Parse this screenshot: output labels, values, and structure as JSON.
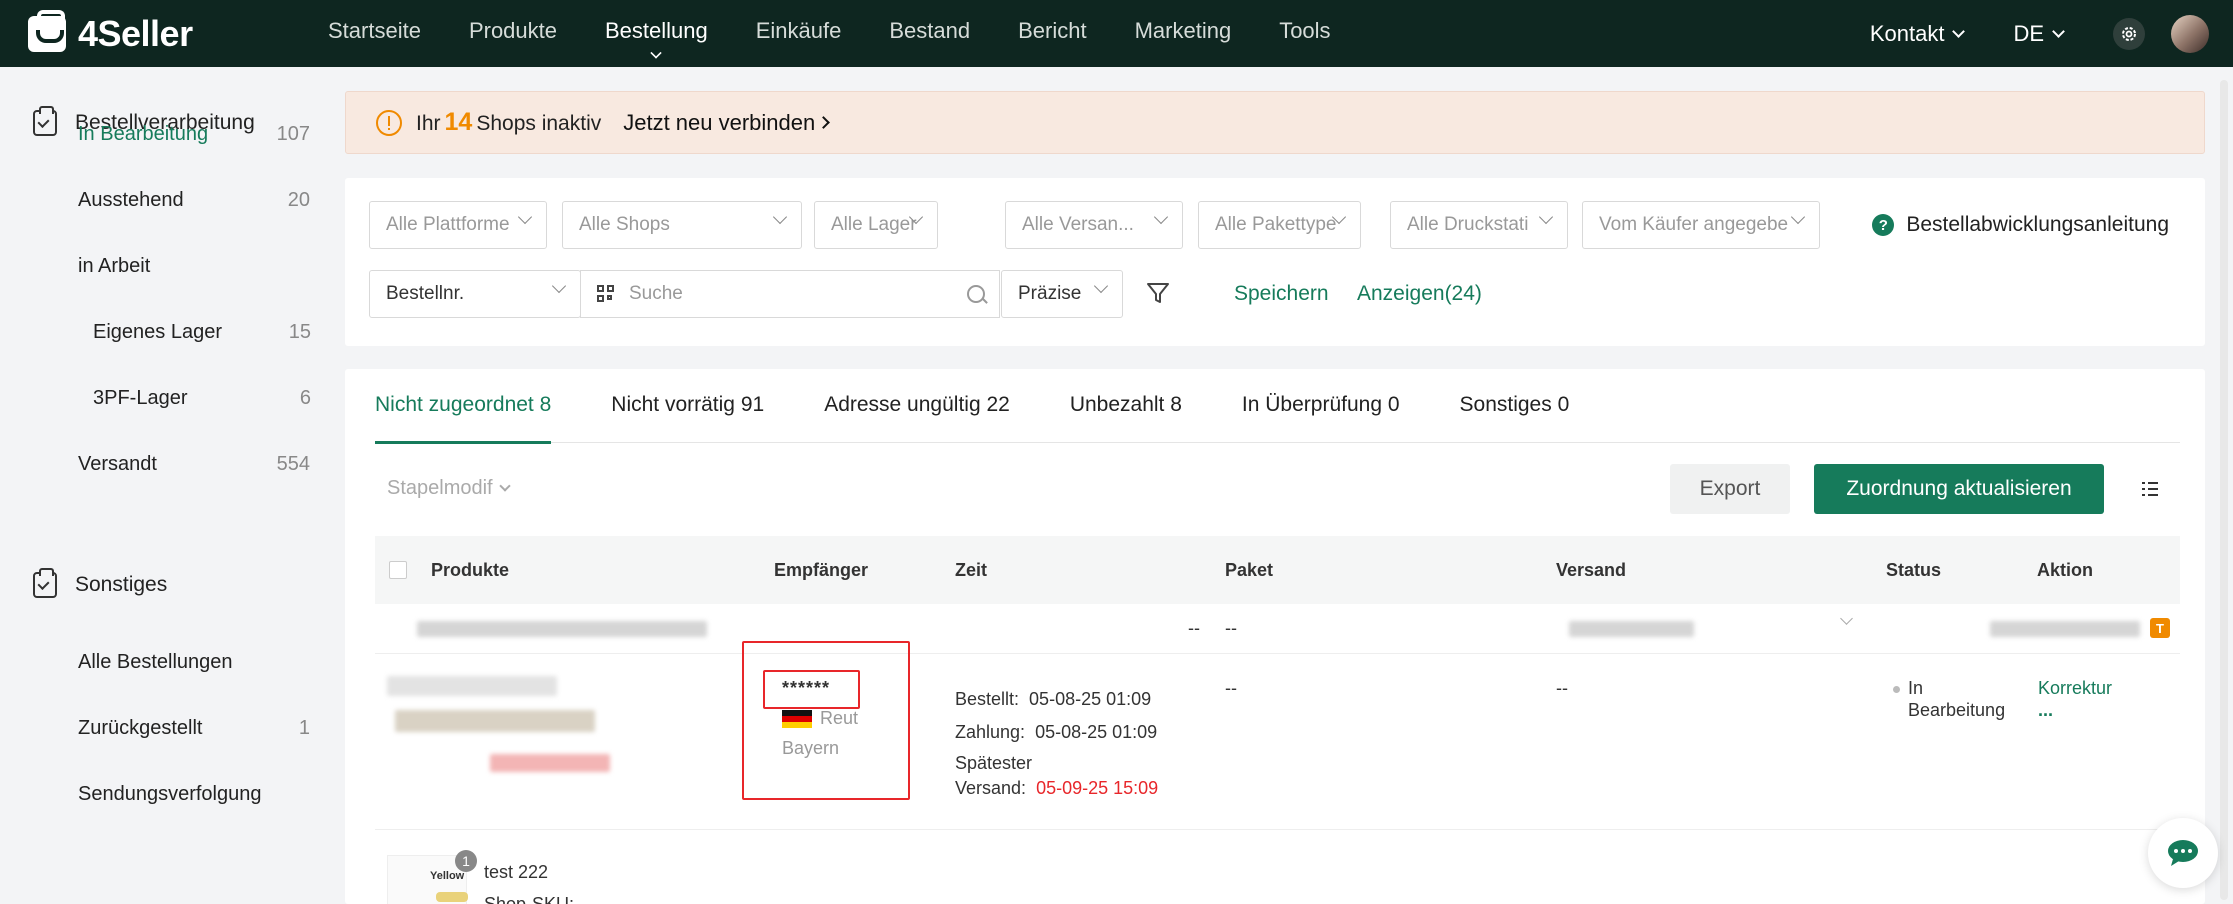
{
  "brand": {
    "name": "4Seller"
  },
  "nav": {
    "items": [
      "Startseite",
      "Produkte",
      "Bestellung",
      "Einkäufe",
      "Bestand",
      "Bericht",
      "Marketing",
      "Tools"
    ],
    "active": "Bestellung",
    "kontakt": "Kontakt",
    "language": "DE"
  },
  "sidebar": {
    "group1": "Bestellverarbeitung",
    "in_bearbeitung": {
      "label": "In Bearbeitung",
      "count": "107"
    },
    "ausstehend": {
      "label": "Ausstehend",
      "count": "20"
    },
    "in_arbeit": {
      "label": "in Arbeit"
    },
    "eigenes_lager": {
      "label": "Eigenes Lager",
      "count": "15"
    },
    "pf_lager": {
      "label": "3PF-Lager",
      "count": "6"
    },
    "versandt": {
      "label": "Versandt",
      "count": "554"
    },
    "group2": "Sonstiges",
    "alle": {
      "label": "Alle Bestellungen"
    },
    "zurueck": {
      "label": "Zurückgestellt",
      "count": "1"
    },
    "tracking": {
      "label": "Sendungsverfolgung"
    }
  },
  "banner": {
    "prefix": "Ihr",
    "count": "14",
    "suffix": "Shops inaktiv",
    "link": "Jetzt neu verbinden"
  },
  "filters": {
    "plattforme": "Alle Plattforme",
    "shops": "Alle Shops",
    "lager": "Alle Lager",
    "versan": "Alle Versan...",
    "pakettype": "Alle Pakettype",
    "druckstat": "Alle Druckstati",
    "kaeufer": "Vom Käufer angegebe",
    "bestellnr": "Bestellnr.",
    "search_placeholder": "Suche",
    "praezise": "Präzise",
    "speichern": "Speichern",
    "anzeigen": "Anzeigen(24)",
    "help": "Bestellabwicklungsanleitung"
  },
  "tabs": [
    {
      "label": "Nicht zugeordnet 8"
    },
    {
      "label": "Nicht vorrätig 91"
    },
    {
      "label": "Adresse ungültig 22"
    },
    {
      "label": "Unbezahlt 8"
    },
    {
      "label": "In Überprüfung 0"
    },
    {
      "label": "Sonstiges 0"
    }
  ],
  "toolbar": {
    "stapel": "Stapelmodif",
    "export": "Export",
    "zuordnung": "Zuordnung aktualisieren"
  },
  "table": {
    "headers": {
      "produkte": "Produkte",
      "empfaenger": "Empfänger",
      "zeit": "Zeit",
      "paket": "Paket",
      "versand": "Versand",
      "status": "Status",
      "aktion": "Aktion"
    },
    "group_row": {
      "dash1": "--",
      "dash2": "--",
      "badge": "T"
    },
    "order": {
      "recipient_name": "******",
      "recipient_city": "Reut",
      "recipient_state": "Bayern",
      "bestellt_label": "Bestellt:",
      "bestellt": "05-08-25 01:09",
      "zahlung_label": "Zahlung:",
      "zahlung": "05-08-25 01:09",
      "spaetester_label": "Spätester",
      "versand_label": "Versand:",
      "spaetester": "05-09-25 15:09",
      "paket": "--",
      "versand": "--",
      "status_line1": "In",
      "status_line2": "Bearbeitung",
      "aktion": "Korrektur",
      "aktion_more": "..."
    },
    "next": {
      "thumb_label": "Yellow",
      "qty": "1",
      "title": "test 222",
      "sku_label": "Shop-SKU:"
    }
  },
  "colors": {
    "accent": "#167b5b",
    "topbar": "#0e2620",
    "warning": "#f08a00",
    "highlight": "#e8262a"
  }
}
